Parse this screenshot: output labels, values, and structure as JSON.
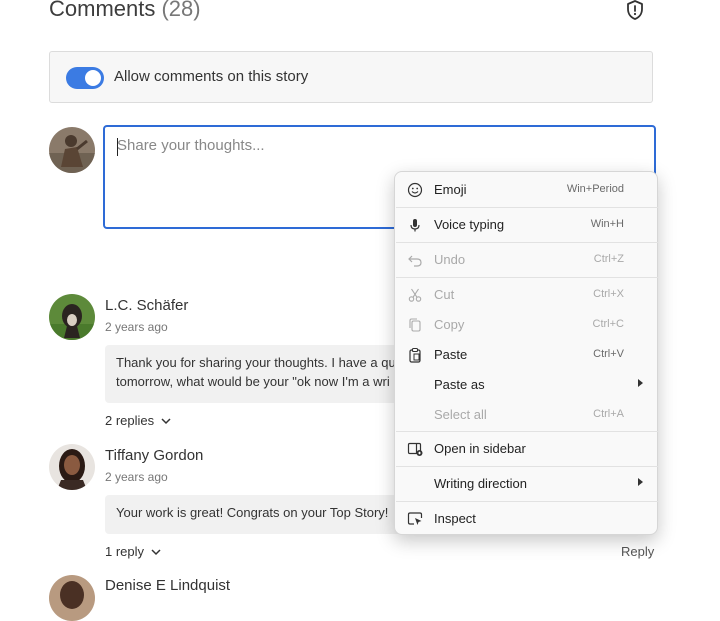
{
  "header": {
    "title": "Comments",
    "count": "(28)"
  },
  "allow": {
    "label": "Allow comments on this story",
    "enabled": true
  },
  "composer": {
    "placeholder": "Share your thoughts..."
  },
  "comments": [
    {
      "author": "L.C. Schäfer",
      "time": "2 years ago",
      "lines": [
        "Thank you for sharing your thoughts. I have a qu",
        "tomorrow, what would be your \"ok now I'm a wri"
      ],
      "replies": "2 replies"
    },
    {
      "author": "Tiffany Gordon",
      "time": "2 years ago",
      "lines": [
        "Your work is great! Congrats on your Top Story!"
      ],
      "replies": "1 reply",
      "reply_label": "Reply"
    },
    {
      "author": "Denise E Lindquist"
    }
  ],
  "context_menu": {
    "items": [
      {
        "icon": "emoji-icon",
        "label": "Emoji",
        "shortcut": "Win+Period",
        "enabled": true
      },
      {
        "icon": "microphone-icon",
        "label": "Voice typing",
        "shortcut": "Win+H",
        "enabled": true
      },
      {
        "icon": "undo-icon",
        "label": "Undo",
        "shortcut": "Ctrl+Z",
        "enabled": false
      },
      {
        "icon": "scissors-icon",
        "label": "Cut",
        "shortcut": "Ctrl+X",
        "enabled": false
      },
      {
        "icon": "copy-icon",
        "label": "Copy",
        "shortcut": "Ctrl+C",
        "enabled": false
      },
      {
        "icon": "clipboard-icon",
        "label": "Paste",
        "shortcut": "Ctrl+V",
        "enabled": true
      },
      {
        "icon": "",
        "label": "Paste as",
        "shortcut": "",
        "enabled": true,
        "submenu": true
      },
      {
        "icon": "",
        "label": "Select all",
        "shortcut": "Ctrl+A",
        "enabled": false
      },
      {
        "icon": "sidebar-icon",
        "label": "Open in sidebar",
        "shortcut": "",
        "enabled": true
      },
      {
        "icon": "",
        "label": "Writing direction",
        "shortcut": "",
        "enabled": true,
        "submenu": true
      },
      {
        "icon": "inspect-icon",
        "label": "Inspect",
        "shortcut": "",
        "enabled": true
      }
    ]
  },
  "colors": {
    "accent": "#2e6bd6",
    "toggle": "#3b7be3"
  }
}
